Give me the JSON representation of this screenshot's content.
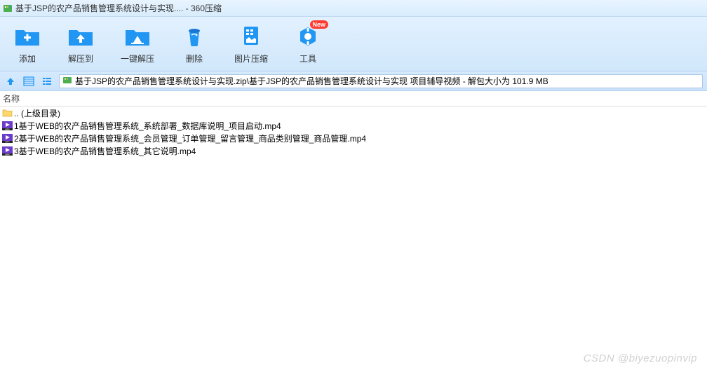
{
  "window": {
    "title": "基于JSP的农产品销售管理系统设计与实现.... - 360压缩"
  },
  "toolbar": {
    "add": "添加",
    "extract_to": "解压到",
    "one_click_extract": "一键解压",
    "delete": "删除",
    "image_compress": "图片压缩",
    "tools": "工具",
    "new_badge": "New"
  },
  "addressbar": {
    "path": "基于JSP的农产品销售管理系统设计与实现.zip\\基于JSP的农产品销售管理系统设计与实现 项目辅导视频 - 解包大小为 101.9 MB"
  },
  "columns": {
    "name": "名称"
  },
  "files": [
    {
      "type": "folder",
      "name": ".. (上级目录)"
    },
    {
      "type": "mp4",
      "name": "1基于WEB的农产品销售管理系统_系统部署_数据库说明_项目启动.mp4"
    },
    {
      "type": "mp4",
      "name": "2基于WEB的农产品销售管理系统_会员管理_订单管理_留言管理_商品类别管理_商品管理.mp4"
    },
    {
      "type": "mp4",
      "name": "3基于WEB的农产品销售管理系统_其它说明.mp4"
    }
  ],
  "watermark": "CSDN @biyezuopinvip"
}
